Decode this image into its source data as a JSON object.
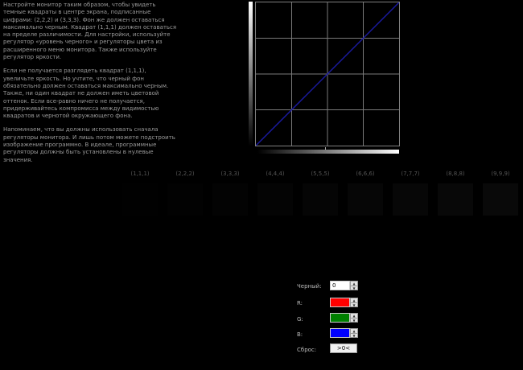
{
  "instructions": {
    "p1": "Настройте монитор таким образом, чтобы увидеть темные квадраты в центре экрана, подписанные цифрами: (2,2,2) и (3,3,3). Фон же должен оставаться максимально черным. Квадрат (1,1,1) должен оставаться на пределе различимости. Для настройки, используйте регулятор «уровень черного» и регуляторы цвета из расширенного меню монитора. Также используйте регулятор яркости.",
    "p2": "Если не получается разглядеть квадрат (1,1,1), увеличьте яркость. Но учтите, что черный фон обязательно должен оставаться максимально черным. Также, ни один квадрат не должен иметь цветовой оттенок. Если все-равно ничего не получается, придерживайтесь компромисса между видимостью квадратов и чернотой окружающего фона.",
    "p3": "Напоминаем, что вы должны использовать сначала регуляторы монитора. И лишь потом можете подстроить изображение программно. В идеале, программные регуляторы должны быть установлены в нулевые значения."
  },
  "squares": [
    {
      "label": "(1,1,1)",
      "color": "#010101"
    },
    {
      "label": "(2,2,2)",
      "color": "#020202"
    },
    {
      "label": "(3,3,3)",
      "color": "#030303"
    },
    {
      "label": "(4,4,4)",
      "color": "#040404"
    },
    {
      "label": "(5,5,5)",
      "color": "#050505"
    },
    {
      "label": "(6,6,6)",
      "color": "#060606"
    },
    {
      "label": "(7,7,7)",
      "color": "#070707"
    },
    {
      "label": "(8,8,8)",
      "color": "#080808"
    },
    {
      "label": "(9,9,9)",
      "color": "#090909"
    }
  ],
  "graph": {
    "curve_color": "#1a1aa0",
    "grid_color": "#7a7a7a"
  },
  "controls": {
    "black_label": "Черный:",
    "black_value": "0",
    "r_label": "R:",
    "r_color": "#ff0000",
    "g_label": "G:",
    "g_color": "#008000",
    "b_label": "B:",
    "b_color": "#0000ff",
    "reset_label": "Сброс:",
    "reset_button": ">0<"
  }
}
